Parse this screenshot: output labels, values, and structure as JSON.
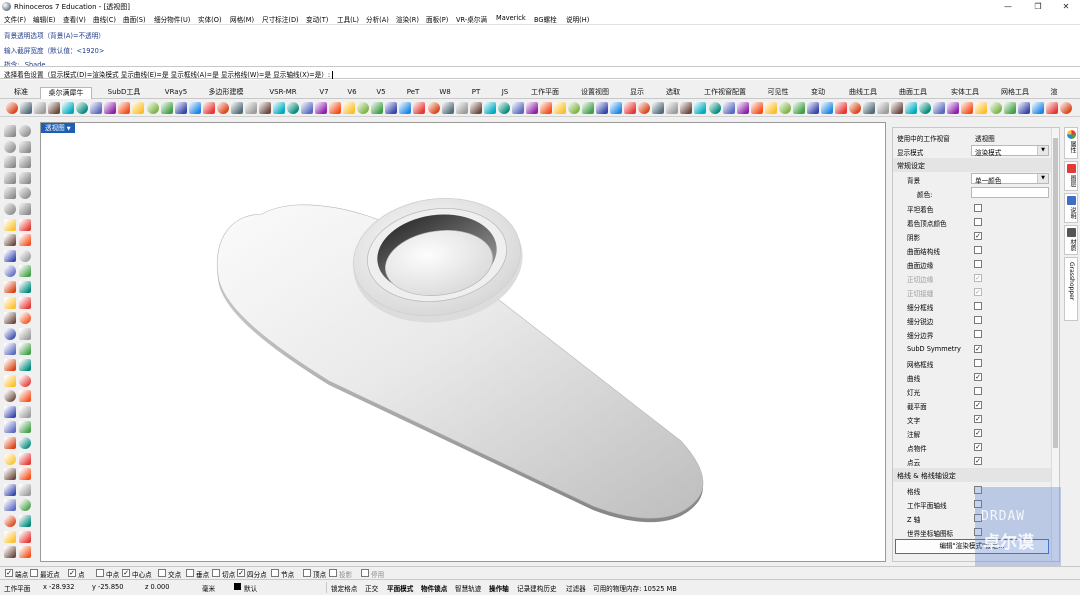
{
  "window": {
    "title": "Rhinoceros 7 Education - [透视图]",
    "controls": [
      "—",
      "❐",
      "✕"
    ]
  },
  "menu": [
    "文件(F)",
    "编辑(E)",
    "查看(V)",
    "曲线(C)",
    "曲面(S)",
    "细分物件(U)",
    "实体(O)",
    "网格(M)",
    "尺寸标注(D)",
    "变动(T)",
    "工具(L)",
    "分析(A)",
    "渲染(R)",
    "面板(P)",
    "VR-桌尔满",
    "Maverick",
    "BG螺栓",
    "说明(H)"
  ],
  "command_history": [
    "背景透明选项（背景(A)=不透明）",
    "输入截屏宽度（默认值：<1920>",
    "指令: _Shade"
  ],
  "command_prompt": "选择着色设置（显示模式(D)=渲染模式  显示曲线(E)=是  显示框线(A)=是  显示格线(W)=是  显示轴线(X)=是）:",
  "tabs": [
    "标准",
    "桌尔满犀牛",
    "SubD工具",
    "VRay5",
    "多边形建模",
    "VSR-MR",
    "V7",
    "V6",
    "V5",
    "PeT",
    "W8",
    "PT",
    "JS",
    "工作平面",
    "设置视图",
    "显示",
    "选取",
    "工作视窗配置",
    "可见性",
    "变动",
    "曲线工具",
    "曲面工具",
    "实体工具",
    "网格工具",
    "渲"
  ],
  "active_tab_index": 1,
  "viewport": {
    "title": "透视图"
  },
  "panel": {
    "rows": [
      {
        "type": "kv",
        "label": "使用中的工作视窗",
        "value": "透视图"
      },
      {
        "type": "select",
        "label": "显示模式",
        "value": "渲染模式"
      },
      {
        "type": "section",
        "label": "常规设定"
      },
      {
        "type": "select",
        "label": "背景",
        "value": "单一颜色",
        "indent": 1
      },
      {
        "type": "color",
        "label": "颜色:",
        "indent": 2
      },
      {
        "type": "check",
        "label": "平坦着色",
        "checked": false,
        "indent": 1
      },
      {
        "type": "check",
        "label": "着色顶点颜色",
        "checked": false,
        "indent": 1
      },
      {
        "type": "check",
        "label": "阴影",
        "checked": true,
        "indent": 1
      },
      {
        "type": "check",
        "label": "曲面结构线",
        "checked": false,
        "indent": 1
      },
      {
        "type": "check",
        "label": "曲面边缘",
        "checked": false,
        "indent": 1
      },
      {
        "type": "check",
        "label": "正切边缘",
        "checked": true,
        "indent": 1,
        "disabled": true
      },
      {
        "type": "check",
        "label": "正切接缝",
        "checked": true,
        "indent": 1,
        "disabled": true
      },
      {
        "type": "check",
        "label": "细分框线",
        "checked": false,
        "indent": 1
      },
      {
        "type": "check",
        "label": "细分锐边",
        "checked": false,
        "indent": 1
      },
      {
        "type": "check",
        "label": "细分边界",
        "checked": false,
        "indent": 1
      },
      {
        "type": "check",
        "label": "SubD Symmetry",
        "checked": true,
        "indent": 1
      },
      {
        "type": "check",
        "label": "网格框线",
        "checked": false,
        "indent": 1
      },
      {
        "type": "check",
        "label": "曲线",
        "checked": true,
        "indent": 1
      },
      {
        "type": "check",
        "label": "灯光",
        "checked": false,
        "indent": 1
      },
      {
        "type": "check",
        "label": "截平面",
        "checked": true,
        "indent": 1
      },
      {
        "type": "check",
        "label": "文字",
        "checked": true,
        "indent": 1
      },
      {
        "type": "check",
        "label": "注解",
        "checked": true,
        "indent": 1
      },
      {
        "type": "check",
        "label": "点物件",
        "checked": true,
        "indent": 1
      },
      {
        "type": "check",
        "label": "点云",
        "checked": true,
        "indent": 1
      },
      {
        "type": "section",
        "label": "格线 & 格线轴设定"
      },
      {
        "type": "check",
        "label": "格线",
        "checked": false,
        "indent": 1
      },
      {
        "type": "check",
        "label": "工作平面轴线",
        "checked": false,
        "indent": 1
      },
      {
        "type": "check",
        "label": "Z 轴",
        "checked": false,
        "indent": 1
      },
      {
        "type": "check",
        "label": "世界坐标轴图标",
        "checked": false,
        "indent": 1
      }
    ],
    "edit_button": "编辑\"渲染模式\"设定..."
  },
  "side_tabs": [
    "属性",
    "图层",
    "说明",
    "材质",
    "Grasshopper"
  ],
  "osnaps": [
    {
      "label": "端点",
      "checked": true
    },
    {
      "label": "最近点",
      "checked": false
    },
    {
      "label": "点",
      "checked": true
    },
    {
      "label": "中点",
      "checked": false
    },
    {
      "label": "中心点",
      "checked": true
    },
    {
      "label": "交点",
      "checked": false
    },
    {
      "label": "垂点",
      "checked": false
    },
    {
      "label": "切点",
      "checked": false
    },
    {
      "label": "四分点",
      "checked": true
    },
    {
      "label": "节点",
      "checked": false
    },
    {
      "label": "顶点",
      "checked": false
    },
    {
      "label": "投影",
      "checked": false,
      "gray": true
    },
    {
      "label": "停用",
      "checked": false,
      "gray": true
    }
  ],
  "status": {
    "cplane": "工作平面",
    "x": "x -28.932",
    "y": "y -25.850",
    "z": "z 0.000",
    "unit": "毫米",
    "layer": "默认",
    "lock_grid": "锁定格点",
    "ortho": "正交",
    "planar": "平面模式",
    "osnap": "物件锁点",
    "smarttrack": "智慧轨迹",
    "gumball": "操作轴",
    "history": "记录建构历史",
    "filter": "过滤器",
    "memory": "可用的物理内存: 10525 MB"
  },
  "watermark": {
    "line1": "DRDAW",
    "line2": "卓尔谟"
  }
}
